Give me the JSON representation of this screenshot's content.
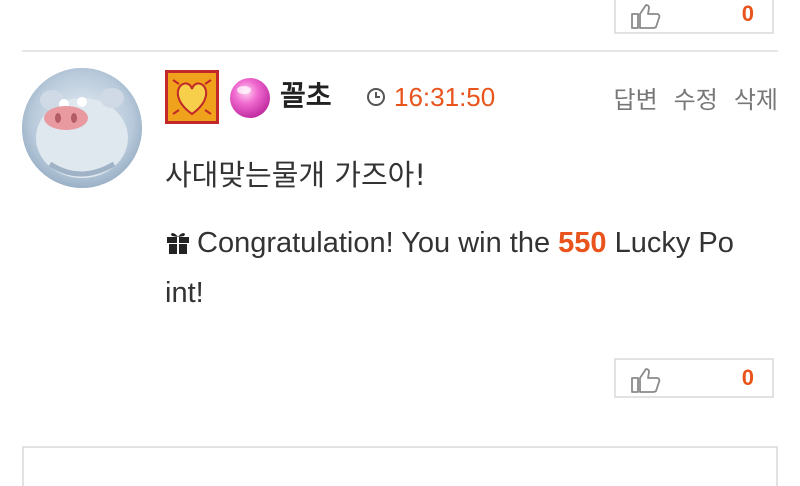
{
  "top_like": {
    "count": "0",
    "icon": "thumbs-up-icon"
  },
  "comment": {
    "username": "꼴초",
    "timestamp": "16:31:50",
    "actions": {
      "reply": "답변",
      "edit": "수정",
      "delete": "삭제"
    },
    "text": "사대맞는물개 가즈아!",
    "prize": {
      "prefix": "Congratulation! You win the ",
      "points": "550",
      "suffix_line1": " Lucky Po",
      "suffix_line2": "int!"
    },
    "like": {
      "count": "0",
      "icon": "thumbs-up-icon"
    }
  },
  "colors": {
    "accent": "#e8541c",
    "border": "#e2e2e2",
    "text": "#333333",
    "muted": "#777777"
  }
}
